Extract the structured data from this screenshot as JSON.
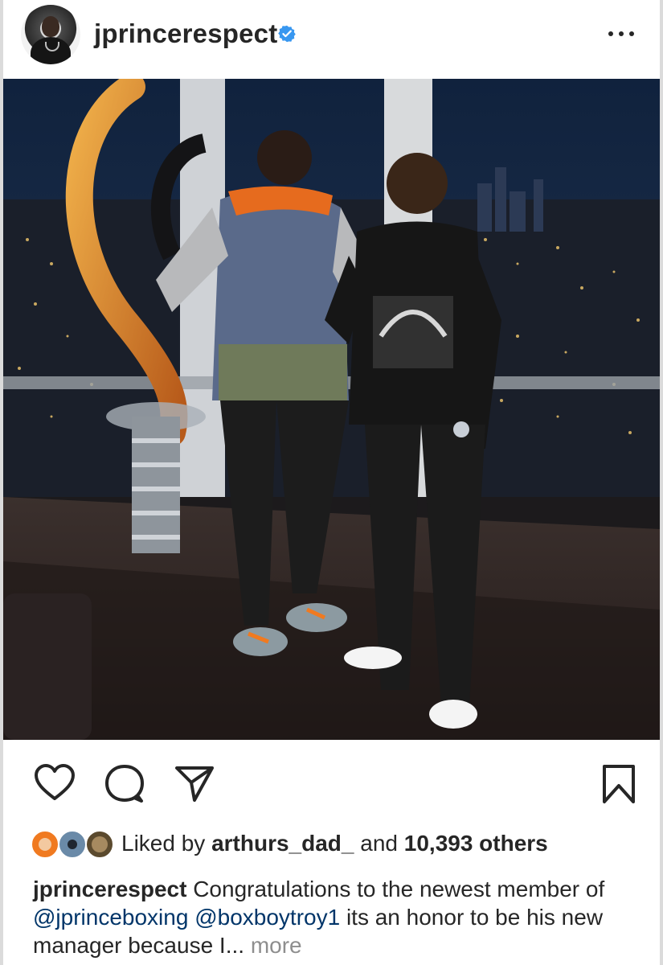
{
  "header": {
    "username": "jprincerespect",
    "verified": true,
    "avatar_icon": "profile-avatar",
    "menu_icon": "more-options-icon"
  },
  "photo": {
    "alt_description_icon": "post-photo"
  },
  "actions": {
    "like_icon": "heart-icon",
    "comment_icon": "comment-icon",
    "share_icon": "send-icon",
    "save_icon": "bookmark-icon"
  },
  "likes": {
    "prefix": "Liked by",
    "liker": "arthurs_dad_",
    "connector": "and",
    "count": "10,393 others"
  },
  "caption": {
    "username": "jprincerespect",
    "text_1": "Congratulations to the newest member of",
    "mention_1": "@jprinceboxing",
    "mention_2": "@boxboytroy1",
    "text_2": "its an honor to be his new manager because I...",
    "more": "more"
  },
  "colors": {
    "text": "#262626",
    "verified": "#3897f0",
    "mention": "#003569",
    "muted": "#8e8e8e"
  }
}
